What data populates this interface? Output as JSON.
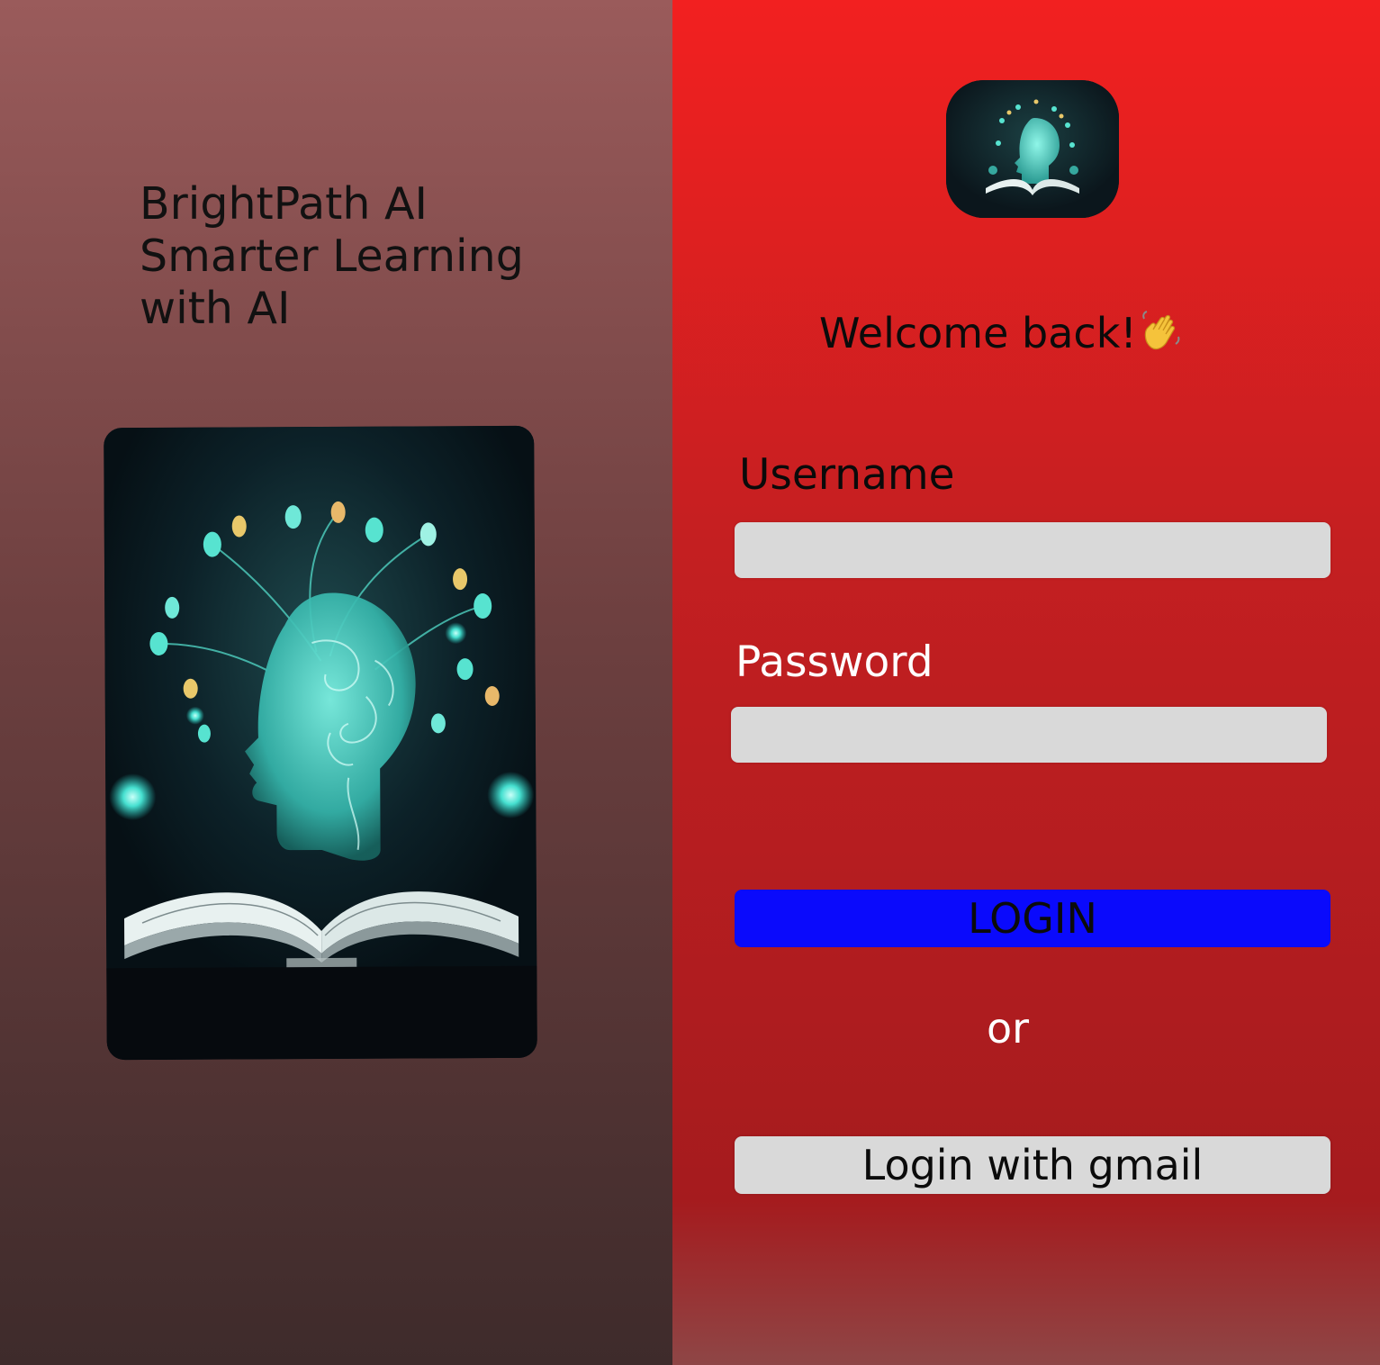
{
  "brand": {
    "tagline_lines": [
      "BrightPath AI",
      "Smarter Learning",
      "with AI"
    ]
  },
  "hero": {
    "image_description_icon": "ai-head-book-illustration"
  },
  "login": {
    "logo_icon": "ai-head-book-logo",
    "welcome_text": "Welcome back!",
    "welcome_emoji": "waving-hand",
    "username_label": "Username",
    "username_value": "",
    "password_label": "Password",
    "password_value": "",
    "login_button_label": "LOGIN",
    "or_text": "or",
    "gmail_button_label": "Login with gmail"
  },
  "colors": {
    "left_panel_top": "#9a5b5b",
    "left_panel_bottom": "#3e2b2b",
    "right_panel": "#e82020",
    "login_button": "#0a0afc",
    "input_background": "#d9d9d9"
  }
}
